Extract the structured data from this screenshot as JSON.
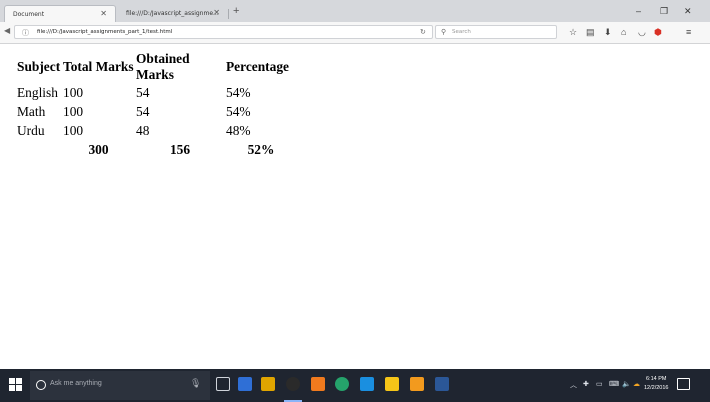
{
  "browser": {
    "tabs": [
      {
        "title": "Document",
        "active": true
      },
      {
        "title": "file:///D:/Javascript_assignme...",
        "active": false
      }
    ],
    "new_tab_icon": "plus-icon",
    "url": "file:///D:/Javascript_assignments_part_1/test.html",
    "search_placeholder": "Search",
    "window_controls": {
      "minimize": "–",
      "maximize": "❐",
      "close": "✕"
    }
  },
  "table": {
    "headers": [
      "Subject",
      "Total Marks",
      "Obtained Marks",
      "Percentage"
    ],
    "rows": [
      [
        "English",
        "100",
        "54",
        "54%"
      ],
      [
        "Math",
        "100",
        "54",
        "54%"
      ],
      [
        "Urdu",
        "100",
        "48",
        "48%"
      ]
    ],
    "totals": [
      "",
      "300",
      "156",
      "52%"
    ]
  },
  "taskbar": {
    "search_placeholder": "Ask me anything",
    "clock_time": "6:14 PM",
    "clock_date": "12/2/2016",
    "app_colors": [
      "#2f6fd6",
      "#e0a500",
      "#2a2a2a",
      "#f07a1e",
      "#25a36b",
      "#1a8fe0",
      "#f5c518",
      "#f29a1e",
      "#2b5797",
      "#3fbf8f"
    ]
  }
}
